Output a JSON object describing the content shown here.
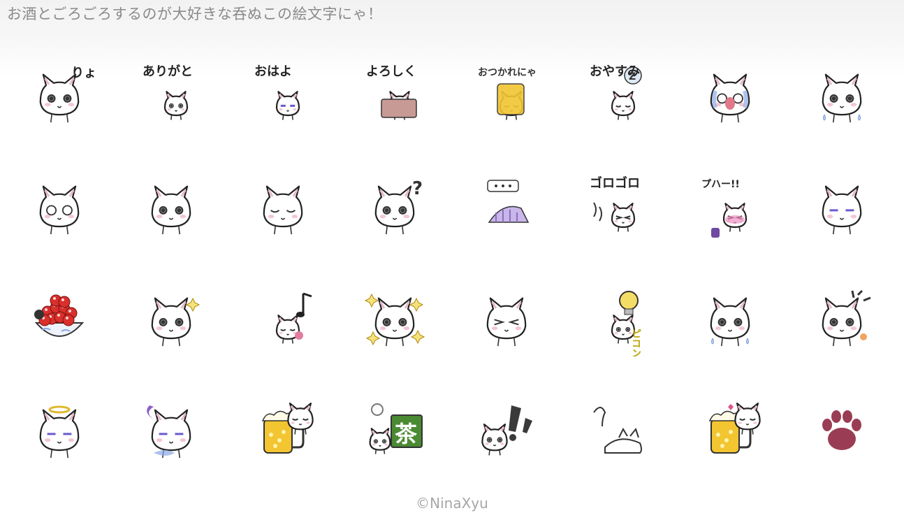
{
  "page": {
    "title": "お酒とごろごろするのが大好きな呑ぬこの絵文字にゃ！",
    "copyright": "©NinaXyu"
  },
  "emoji_grid": {
    "rows": 4,
    "cols": 8,
    "items": [
      {
        "icon": "cat-ryo-icon",
        "text": "りょ!"
      },
      {
        "icon": "cat-arigato-icon",
        "text": "ありがと"
      },
      {
        "icon": "cat-ohayo-icon",
        "text": "おはよ"
      },
      {
        "icon": "cat-yoroshiku-icon",
        "text": "よろしく"
      },
      {
        "icon": "cat-otsukare-beer-icon",
        "text": "おつかれにゃ"
      },
      {
        "icon": "cat-oyasumi-icon",
        "text": "おやすみ"
      },
      {
        "icon": "cat-crying-icon",
        "text": ""
      },
      {
        "icon": "cat-sad-icon",
        "text": ""
      },
      {
        "icon": "cat-surprised-icon",
        "text": ""
      },
      {
        "icon": "cat-happy-icon",
        "text": ""
      },
      {
        "icon": "cat-smile-icon",
        "text": ""
      },
      {
        "icon": "cat-question-icon",
        "text": ""
      },
      {
        "icon": "cat-blanket-icon",
        "text": ""
      },
      {
        "icon": "cat-gorogoro-icon",
        "text": "ゴロゴロ"
      },
      {
        "icon": "cat-puha-icon",
        "text": "プハー!!"
      },
      {
        "icon": "cat-shy-icon",
        "text": ""
      },
      {
        "icon": "ikura-bowl-icon",
        "text": ""
      },
      {
        "icon": "cat-sparkle-icon",
        "text": ""
      },
      {
        "icon": "cat-music-icon",
        "text": ""
      },
      {
        "icon": "cat-sparkles-icon",
        "text": ""
      },
      {
        "icon": "cat-laugh-icon",
        "text": ""
      },
      {
        "icon": "cat-lightbulb-icon",
        "text": "ピコン"
      },
      {
        "icon": "cat-tears-icon",
        "text": ""
      },
      {
        "icon": "cat-shock-icon",
        "text": ""
      },
      {
        "icon": "cat-angel-icon",
        "text": ""
      },
      {
        "icon": "cat-ghost-icon",
        "text": ""
      },
      {
        "icon": "beer-mug-cat-icon",
        "text": ""
      },
      {
        "icon": "cat-tea-icon",
        "text": "茶"
      },
      {
        "icon": "cat-exclaim-icon",
        "text": ""
      },
      {
        "icon": "cat-lying-icon",
        "text": ""
      },
      {
        "icon": "cat-beer-heart-icon",
        "text": ""
      },
      {
        "icon": "paw-print-icon",
        "text": ""
      }
    ]
  },
  "colors": {
    "outline": "#222222",
    "cheek": "#f3b6c8",
    "beer": "#f2c531",
    "tea": "#4a8a32",
    "ikura": "#d9302c",
    "paw": "#9a3d54",
    "blue": "#8aa9e6",
    "purple": "#8a5ec9"
  }
}
